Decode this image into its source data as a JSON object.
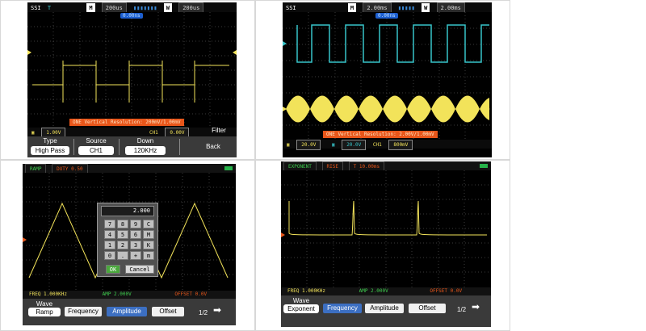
{
  "panel1": {
    "topbar": {
      "logo": "SSI",
      "mode": "T",
      "m_label": "M",
      "m_value": "200us",
      "w_label": "W",
      "w_value": "200us"
    },
    "trigger_pill": "0.00ns",
    "notice": "ONE Vertical Resolution: 200mV/1.00mV",
    "status": {
      "ch_value": "1.00V",
      "trig_label": "CH1",
      "trig_value": "0.00V"
    },
    "menu": {
      "type_label": "Type",
      "type_value": "High Pass",
      "source_label": "Source",
      "source_value": "CH1",
      "down_label": "Down",
      "down_value": "120KHz",
      "filter_label": "Filter",
      "back_label": "Back"
    }
  },
  "panel2": {
    "topbar": {
      "logo": "SSI",
      "m_label": "M",
      "m_value": "2.00ms",
      "w_label": "W",
      "w_value": "2.00ms"
    },
    "trigger_pill": "0.00ns",
    "notice": "ONE Vertical Resolution: 2.00V/1.00mV",
    "status": {
      "ch1_value": "20.0V",
      "ch2_value": "20.0V",
      "trig_label": "CH1",
      "trig_value": "800mV"
    }
  },
  "panel3": {
    "top": {
      "wave": "RAMP",
      "param": "DUTY 0.50"
    },
    "keypad": {
      "display": "2.000",
      "keys": [
        "7",
        "8",
        "9",
        "C",
        "4",
        "5",
        "6",
        "M",
        "1",
        "2",
        "3",
        "K",
        "0",
        ".",
        "+",
        "m"
      ],
      "ok": "OK",
      "cancel": "Cancel"
    },
    "bottom": {
      "freq": "FREQ 1.000KHz",
      "amp": "AMP 2.000V",
      "offset": "OFFSET 0.0V"
    },
    "menu": {
      "wave_label": "Wave",
      "wave_value": "Ramp",
      "frequency": "Frequency",
      "amplitude": "Amplitude",
      "offset": "Offset",
      "page": "1/2"
    }
  },
  "panel4": {
    "top": {
      "wave": "EXPONENT",
      "param": "RISE",
      "time": "T 10.00ms"
    },
    "bottom": {
      "freq": "FREQ 1.000KHz",
      "amp": "AMP 2.000V",
      "offset": "OFFSET 0.0V"
    },
    "menu": {
      "wave_label": "Wave",
      "wave_value": "Exponent",
      "frequency": "Frequency",
      "amplitude": "Amplitude",
      "offset": "Offset",
      "page": "1/2"
    }
  },
  "colors": {
    "ch1_yellow": "#f2e35a",
    "ch2_cyan": "#37c4c9",
    "notice_orange": "#e8561a",
    "menu_active_blue": "#3c6fc2",
    "ok_green": "#4aa83d"
  }
}
